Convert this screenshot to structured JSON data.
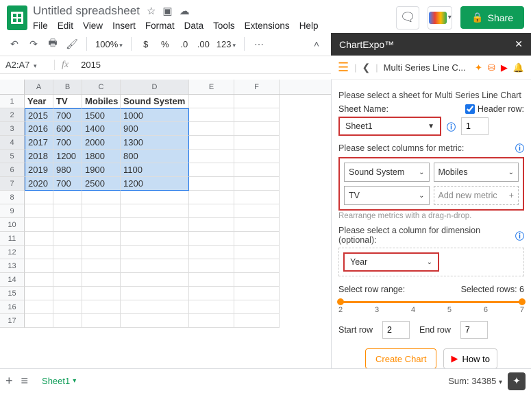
{
  "doc": {
    "title": "Untitled spreadsheet"
  },
  "menus": [
    "File",
    "Edit",
    "View",
    "Insert",
    "Format",
    "Data",
    "Tools",
    "Extensions",
    "Help"
  ],
  "share": "Share",
  "toolbar": {
    "zoom": "100%",
    "dollar": "$",
    "percent": "%",
    "dec0": ".0",
    "dec00": ".00",
    "num": "123"
  },
  "formula": {
    "ref": "A2:A7",
    "fx": "fx",
    "val": "2015"
  },
  "col_headers": [
    "A",
    "B",
    "C",
    "D",
    "E",
    "F"
  ],
  "table": {
    "headers": [
      "Year",
      "TV",
      "Mobiles",
      "Sound System"
    ],
    "rows": [
      [
        "2015",
        "700",
        "1500",
        "1000"
      ],
      [
        "2016",
        "600",
        "1400",
        "900"
      ],
      [
        "2017",
        "700",
        "2000",
        "1300"
      ],
      [
        "2018",
        "1200",
        "1800",
        "800"
      ],
      [
        "2019",
        "980",
        "1900",
        "1100"
      ],
      [
        "2020",
        "700",
        "2500",
        "1200"
      ]
    ]
  },
  "panel": {
    "title": "ChartExpo™"
  },
  "sidebar": {
    "nav_title": "Multi Series Line C...",
    "l1": "Please select a sheet for Multi Series Line Chart",
    "sheet_name_label": "Sheet Name:",
    "header_row_label": "Header row:",
    "sheet_name": "Sheet1",
    "header_row_val": "1",
    "l2": "Please select columns for metric:",
    "metric1": "Sound System",
    "metric2": "Mobiles",
    "metric3": "TV",
    "add_metric": "Add new metric",
    "rearrange": "Rearrange metrics with a drag-n-drop.",
    "l3": "Please select a column for dimension (optional):",
    "dimension": "Year",
    "range_label": "Select row range:",
    "selected_rows": "Selected rows: 6",
    "slider_labels": [
      "2",
      "3",
      "4",
      "5",
      "6",
      "7"
    ],
    "start_row_label": "Start row",
    "start_row": "2",
    "end_row_label": "End row",
    "end_row": "7",
    "create": "Create Chart",
    "howto": "How to"
  },
  "footer": {
    "sheet": "Sheet1",
    "sum": "Sum: 34385"
  }
}
